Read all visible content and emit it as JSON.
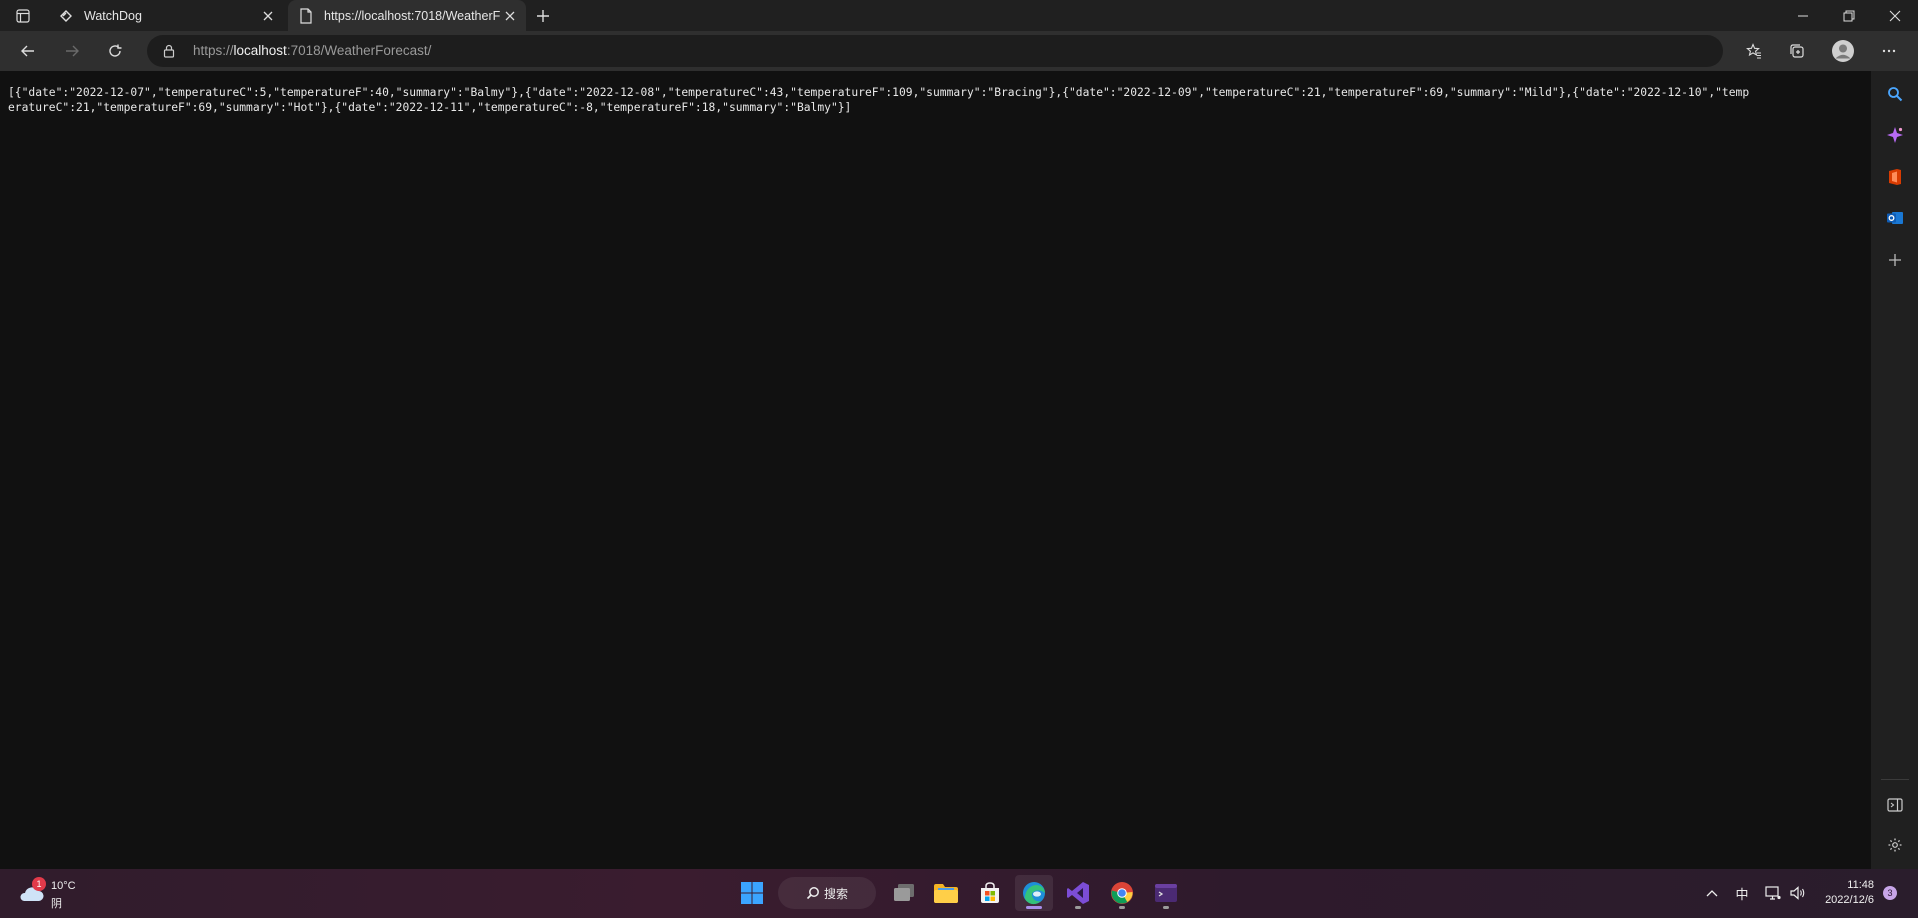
{
  "browser": {
    "tabs": [
      {
        "label": "WatchDog",
        "active": false
      },
      {
        "label": "https://localhost:7018/WeatherF",
        "active": true
      }
    ],
    "address": {
      "scheme": "https://",
      "host": "localhost",
      "path": ":7018/WeatherForecast/"
    }
  },
  "page": {
    "json_text": "[{\"date\":\"2022-12-07\",\"temperatureC\":5,\"temperatureF\":40,\"summary\":\"Balmy\"},{\"date\":\"2022-12-08\",\"temperatureC\":43,\"temperatureF\":109,\"summary\":\"Bracing\"},{\"date\":\"2022-12-09\",\"temperatureC\":21,\"temperatureF\":69,\"summary\":\"Mild\"},{\"date\":\"2022-12-10\",\"temperatureC\":21,\"temperatureF\":69,\"summary\":\"Hot\"},{\"date\":\"2022-12-11\",\"temperatureC\":-8,\"temperatureF\":18,\"summary\":\"Balmy\"}]"
  },
  "taskbar": {
    "weather": {
      "badge": "1",
      "temperature": "10°C",
      "condition": "阴"
    },
    "search_label": "搜索",
    "apps": [
      "task-view",
      "file-explorer",
      "microsoft-store",
      "edge",
      "visual-studio",
      "chrome",
      "terminal"
    ],
    "active_app": "edge",
    "tray": {
      "ime": "中"
    },
    "clock": {
      "time": "11:48",
      "date": "2022/12/6"
    },
    "notification_count": "3"
  },
  "colors": {
    "page_bg": "#111111",
    "tab_strip": "#202020",
    "toolbar": "#2f2f2f",
    "taskbar_start": "#301c2c",
    "accent": "#a98ee8"
  }
}
